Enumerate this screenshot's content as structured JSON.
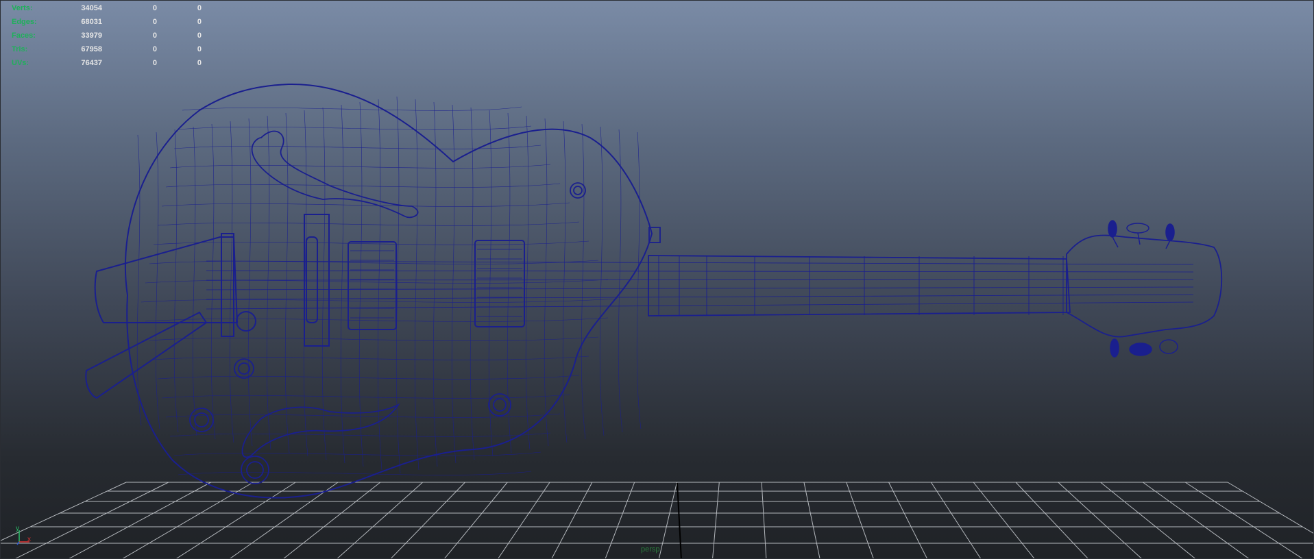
{
  "hud": {
    "rows": [
      {
        "label": "Verts:",
        "v1": "34054",
        "v2": "0",
        "v3": "0"
      },
      {
        "label": "Edges:",
        "v1": "68031",
        "v2": "0",
        "v3": "0"
      },
      {
        "label": "Faces:",
        "v1": "33979",
        "v2": "0",
        "v3": "0"
      },
      {
        "label": "Tris:",
        "v1": "67958",
        "v2": "0",
        "v3": "0"
      },
      {
        "label": "UVs:",
        "v1": "76437",
        "v2": "0",
        "v3": "0"
      }
    ]
  },
  "axis": {
    "y_label": "y",
    "x_label": "x"
  },
  "camera": {
    "label": "persp"
  },
  "colors": {
    "wireframe": "#1a1f8e",
    "grid": "#cfd3d8",
    "hud_label": "#1fb05a",
    "hud_value": "#e6e6e6"
  }
}
